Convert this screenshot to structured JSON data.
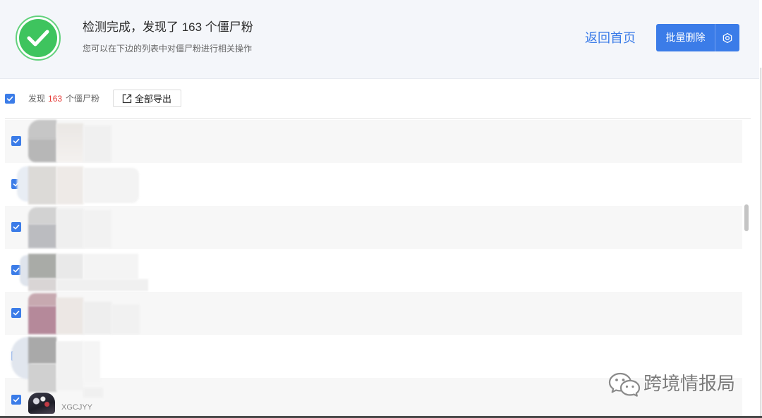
{
  "theme": {
    "primary": "#3b7ce8",
    "success": "#3ec45e",
    "count_red": "#e53935"
  },
  "header": {
    "status_icon": "check-circle-icon",
    "title": "检测完成，发现了 163 个僵尸粉",
    "subtitle": "您可以在下边的列表中对僵尸粉进行相关操作",
    "back_home_label": "返回首页",
    "batch_delete_label": "批量删除",
    "settings_icon": "gear-icon"
  },
  "toolbar": {
    "select_all_checked": true,
    "found_prefix": "发现",
    "found_count": "163",
    "found_suffix": "个僵尸粉",
    "export_icon": "external-link-icon",
    "export_label": "全部导出"
  },
  "list": {
    "rows": [
      {
        "checked": true
      },
      {
        "checked": true
      },
      {
        "checked": true
      },
      {
        "checked": true
      },
      {
        "checked": true
      },
      {
        "checked": true
      },
      {
        "checked": true,
        "handle": "XGCJYY"
      }
    ]
  },
  "watermark": {
    "icon": "wechat-icon",
    "text": "跨境情报局"
  }
}
